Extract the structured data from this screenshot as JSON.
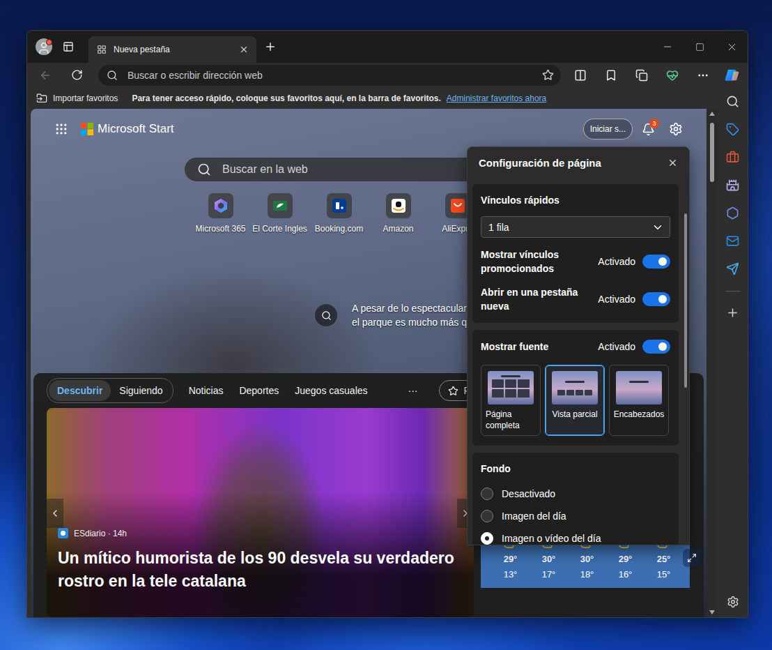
{
  "browser_tabs": [
    {
      "label": "Nueva pestaña",
      "selected": true
    }
  ],
  "navigation": {
    "back_disabled": true
  },
  "profile": {
    "has_notification": true
  },
  "address_bar": {
    "placeholder": "Buscar o escribir dirección web"
  },
  "favorites_bar": {
    "import_label": "Importar favoritos",
    "hint": "Para tener acceso rápido, coloque sus favoritos aquí, en la barra de favoritos.",
    "link": "Administrar favoritos ahora"
  },
  "page": {
    "brand": "Microsoft Start",
    "sign_in": "Iniciar s...",
    "notification_count": "3",
    "search_placeholder": "Buscar en la web",
    "quick_links": [
      {
        "label": "Microsoft 365",
        "kind": "m365",
        "color": "#7b6cf0"
      },
      {
        "label": "El Corte Ingles",
        "kind": "corteingles",
        "color": "#1c7a3e"
      },
      {
        "label": "Booking.com",
        "kind": "booking",
        "color": "#003b95"
      },
      {
        "label": "Amazon",
        "kind": "amazon",
        "color": "#ffffff"
      },
      {
        "label": "AliExpre",
        "kind": "aliexpress",
        "color": "#ff4a1c"
      }
    ],
    "caption_lines": [
      "A pesar de lo espectacular",
      "el parque es mucho más q"
    ]
  },
  "feed": {
    "view_switch": [
      {
        "label": "Descubrir",
        "selected": true
      },
      {
        "label": "Siguiendo",
        "selected": false
      }
    ],
    "categories": [
      "Noticias",
      "Deportes",
      "Juegos casuales"
    ],
    "more": "···",
    "personalize": "Pe",
    "card": {
      "meta": "ESdiario · 14h",
      "title": "Un mítico humorista de los 90 desvela su verdadero rostro en la tele catalana"
    },
    "weather": [
      {
        "high": "29°",
        "low": "13°"
      },
      {
        "high": "30°",
        "low": "17°"
      },
      {
        "high": "30°",
        "low": "18°"
      },
      {
        "high": "29°",
        "low": "16°"
      },
      {
        "high": "25°",
        "low": "15°"
      }
    ]
  },
  "settings": {
    "title": "Configuración de página",
    "quick_links": {
      "heading": "Vínculos rápidos",
      "rows_value": "1 fila",
      "toggles": [
        {
          "label": "Mostrar vínculos promocionados",
          "state_label": "Activado",
          "on": true
        },
        {
          "label": "Abrir en una pestaña nueva",
          "state_label": "Activado",
          "on": true
        }
      ]
    },
    "feed": {
      "heading": "Mostrar fuente",
      "state_label": "Activado",
      "on": true,
      "layouts": [
        {
          "label": "Página completa",
          "kind": "full",
          "selected": false
        },
        {
          "label": "Vista parcial",
          "kind": "partial",
          "selected": true
        },
        {
          "label": "Encabezados",
          "kind": "headings",
          "selected": false
        }
      ]
    },
    "background": {
      "heading": "Fondo",
      "options": [
        {
          "label": "Desactivado",
          "selected": false
        },
        {
          "label": "Imagen del día",
          "selected": false
        },
        {
          "label": "Imagen o vídeo del día",
          "selected": true
        }
      ]
    }
  }
}
